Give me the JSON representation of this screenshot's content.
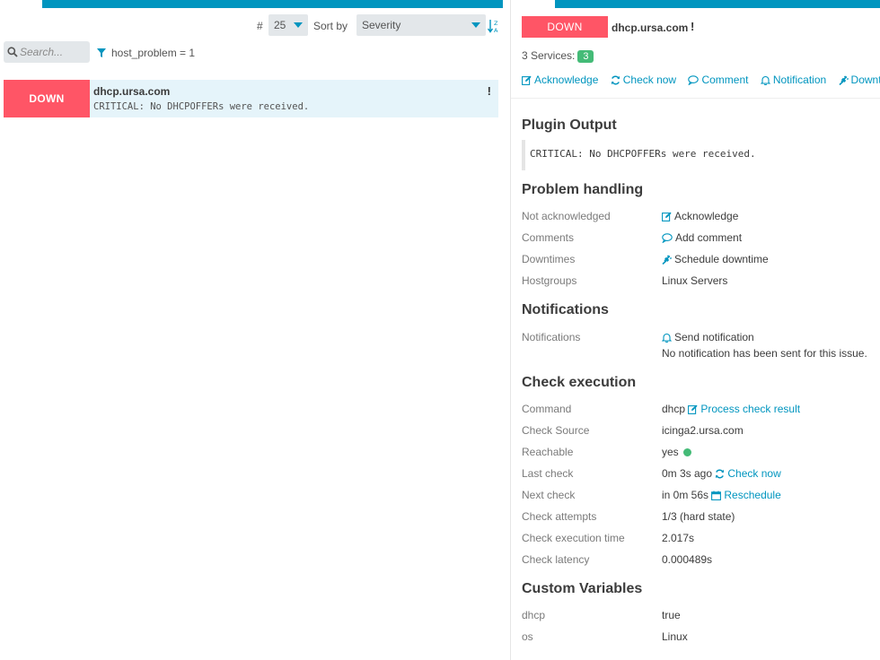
{
  "list": {
    "controls": {
      "limit_hash": "#",
      "limit_value": "25",
      "sort_label": "Sort by",
      "sort_value": "Severity",
      "search_placeholder": "Search...",
      "filter_text": "host_problem = 1"
    },
    "rows": [
      {
        "state": "DOWN",
        "host": "dhcp.ursa.com",
        "output": "CRITICAL: No DHCPOFFERs were received.",
        "flag": "!"
      }
    ]
  },
  "detail": {
    "state": "DOWN",
    "host": "dhcp.ursa.com",
    "flag": "!",
    "services_label": "3 Services:",
    "services_count": "3",
    "actions": {
      "acknowledge": "Acknowledge",
      "check_now": "Check now",
      "comment": "Comment",
      "notification": "Notification",
      "downtime": "Downtime"
    },
    "plugin_output": {
      "title": "Plugin Output",
      "text": "CRITICAL: No DHCPOFFERs were received."
    },
    "problem_handling": {
      "title": "Problem handling",
      "not_ack_label": "Not acknowledged",
      "ack_link": "Acknowledge",
      "comments_label": "Comments",
      "add_comment_link": "Add comment",
      "downtimes_label": "Downtimes",
      "schedule_downtime_link": "Schedule downtime",
      "hostgroups_label": "Hostgroups",
      "hostgroups_value": "Linux Servers"
    },
    "notifications": {
      "title": "Notifications",
      "label": "Notifications",
      "send_link": "Send notification",
      "note": "No notification has been sent for this issue."
    },
    "check_execution": {
      "title": "Check execution",
      "command_label": "Command",
      "command_value": "dhcp",
      "process_link": "Process check result",
      "source_label": "Check Source",
      "source_value": "icinga2.ursa.com",
      "reachable_label": "Reachable",
      "reachable_value": "yes",
      "last_label": "Last check",
      "last_value": "0m 3s ago",
      "check_now_link": "Check now",
      "next_label": "Next check",
      "next_value": "in 0m 56s",
      "reschedule_link": "Reschedule",
      "attempts_label": "Check attempts",
      "attempts_value": "1/3 (hard state)",
      "exec_time_label": "Check execution time",
      "exec_time_value": "2.017s",
      "latency_label": "Check latency",
      "latency_value": "0.000489s"
    },
    "custom_vars": {
      "title": "Custom Variables",
      "vars": [
        {
          "key": "dhcp",
          "value": "true"
        },
        {
          "key": "os",
          "value": "Linux"
        }
      ]
    }
  },
  "colors": {
    "accent": "#0095bf",
    "down": "#ff5566",
    "ok": "#44bb77",
    "row_bg": "#e5f4fa"
  }
}
